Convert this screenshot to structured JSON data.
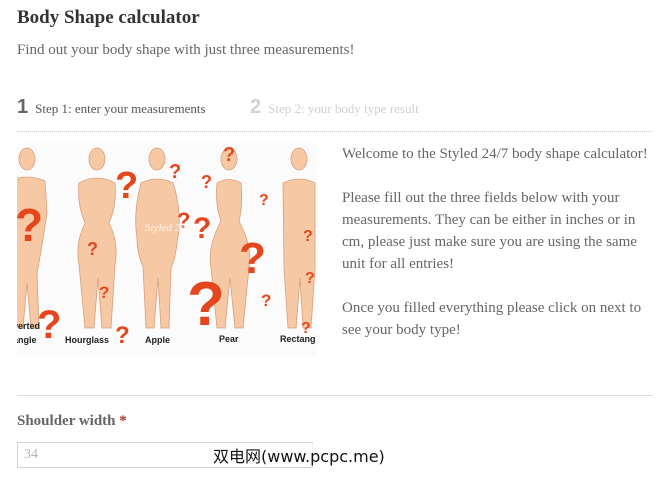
{
  "header": {
    "title": "Body Shape calculator",
    "subtitle": "Find out your body shape with just three measurements!"
  },
  "steps": [
    {
      "number": "1",
      "label": "Step 1: enter your measurements",
      "active": true
    },
    {
      "number": "2",
      "label": "Step 2: your body type result",
      "active": false
    }
  ],
  "illustration": {
    "labels": [
      "verted",
      "angle",
      "Hourglass",
      "Apple",
      "Pear",
      "Rectang"
    ],
    "watermark": "Styled 24/7",
    "accent": "#e4471d",
    "skin": "#f6c8a4"
  },
  "intro": {
    "p1": "Welcome to the Styled 24/7 body shape calculator!",
    "p2": "Please fill out the three fields below with your measurements. They can be either in inches or in cm, please just make sure you are using the same unit for all entries!",
    "p3": "Once you filled everything please click on next to see your body type!"
  },
  "form": {
    "shoulder": {
      "label": "Shoulder width",
      "required_marker": "*",
      "placeholder": "34",
      "value": ""
    }
  },
  "watermark_text": "双电网(www.pcpc.me)"
}
